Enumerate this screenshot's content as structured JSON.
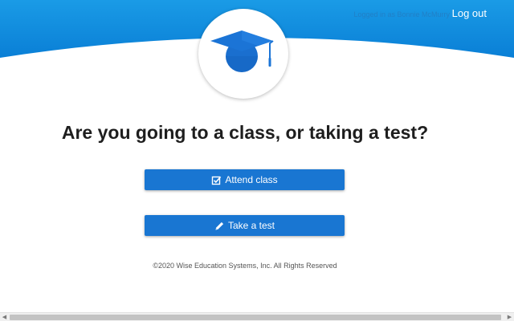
{
  "header": {
    "logged_in_text": "Logged in as Bonnie McMurry",
    "logout_label": "Log out"
  },
  "logo": {
    "icon": "graduation-cap-icon"
  },
  "main": {
    "title": "Are you going to a class, or taking a test?",
    "attend_label": "Attend class",
    "attend_icon": "checkbox-icon",
    "test_label": "Take a test",
    "test_icon": "pencil-icon"
  },
  "footer": {
    "copyright": "©2020 Wise Education Systems, Inc. All Rights Reserved"
  },
  "colors": {
    "brand_blue": "#1976d2",
    "header_blue": "#0a8ee0"
  }
}
